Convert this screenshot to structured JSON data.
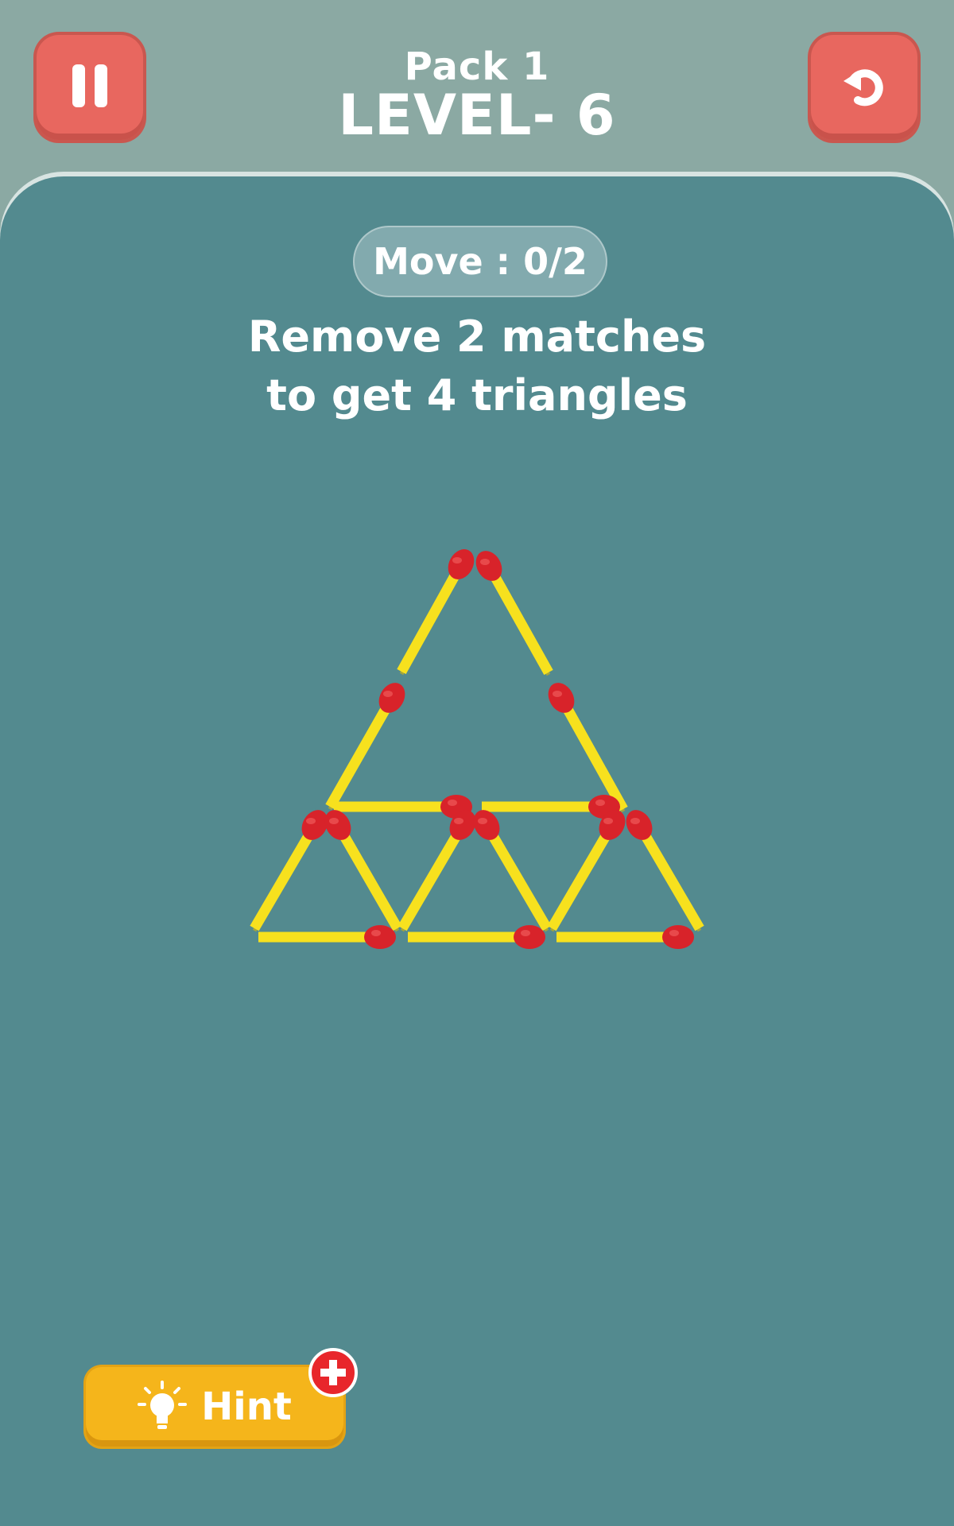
{
  "header": {
    "pack_label": "Pack 1",
    "level_label": "LEVEL- 6"
  },
  "game": {
    "move_label": "Move : 0/2",
    "instruction_line1": "Remove 2 matches",
    "instruction_line2": "to get 4 triangles"
  },
  "footer": {
    "hint_label": "Hint"
  },
  "icons": {
    "pause": "pause-icon",
    "restart": "restart-icon",
    "hint": "lightbulb-icon",
    "add": "plus-icon"
  },
  "colors": {
    "background_top": "#8ba9a3",
    "board": "#538a8f",
    "button_red": "#e8675f",
    "hint_yellow": "#f5b51b",
    "match_stick": "#f7e11e",
    "match_head": "#d8232a"
  }
}
